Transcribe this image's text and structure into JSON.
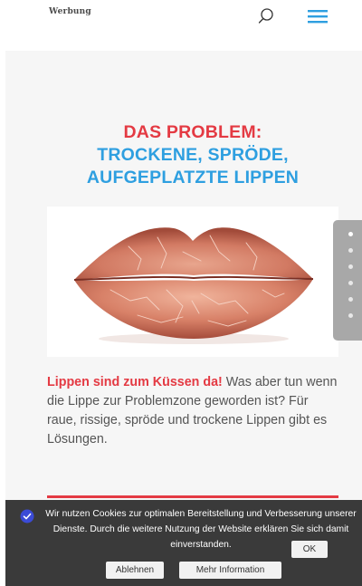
{
  "header": {
    "brand": "Werbung",
    "icons": {
      "search": "search-icon",
      "menu": "hamburger-menu-icon"
    },
    "accent_color": "#2e9fe0"
  },
  "hero": {
    "title_line1": "DAS PROBLEM:",
    "title_line2": "TROCKENE, SPRÖDE,",
    "title_line3": "AUFGEPLATZTE LIPPEN",
    "title_color_1": "#e43a43",
    "title_color_2": "#2e9fe0"
  },
  "intro": {
    "highlight": "Lippen sind zum Küssen da!",
    "text": " Was aber tun wenn die Lippe zur Problemzone geworden ist? Für raue, rissige, spröde und trockene Lippen gibt es Lösungen."
  },
  "slide_nav": {
    "count": 6,
    "active_index": 0
  },
  "cookie_banner": {
    "text": "Wir nutzen Cookies zur optimalen Bereitstellung und Verbesserung unserer Dienste. Durch die weitere Nutzung der Website erklären Sie sich damit einverstanden.",
    "ok_label": "OK",
    "decline_label": "Ablehnen",
    "more_label": "Mehr Information",
    "icon": "privacy-shield-icon"
  }
}
